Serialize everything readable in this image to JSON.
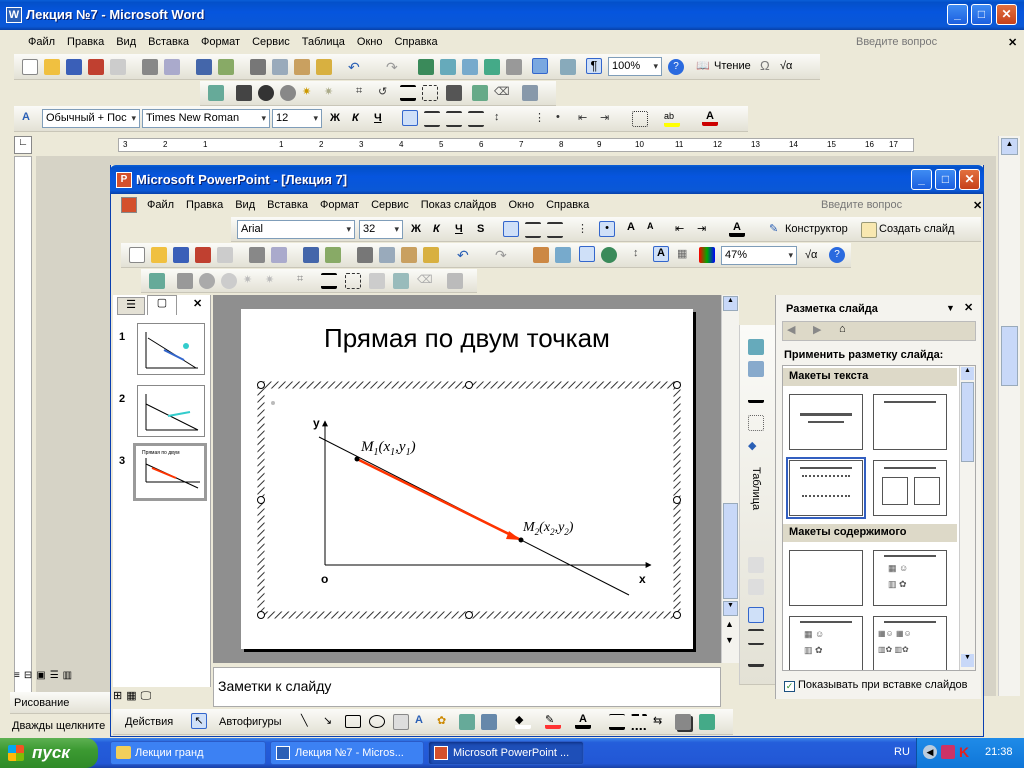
{
  "word": {
    "title": "Лекция №7 - Microsoft Word",
    "menu": [
      "Файл",
      "Правка",
      "Вид",
      "Вставка",
      "Формат",
      "Сервис",
      "Таблица",
      "Окно",
      "Справка"
    ],
    "help_placeholder": "Введите вопрос",
    "zoom": "100%",
    "reading": "Чтение",
    "style": "Обычный + Пос",
    "font": "Times New Roman",
    "size": "12",
    "bold": "Ж",
    "italic": "К",
    "underline": "Ч",
    "ruler_ticks": [
      "3",
      "2",
      "1",
      "1",
      "2",
      "3",
      "4",
      "5",
      "6",
      "7",
      "8",
      "9",
      "10",
      "11",
      "12",
      "13",
      "14",
      "15",
      "16",
      "17"
    ],
    "draw_label": "Рисование",
    "status_text": "Дважды щелкните"
  },
  "ppt": {
    "title": "Microsoft PowerPoint - [Лекция 7]",
    "menu": [
      "Файл",
      "Правка",
      "Вид",
      "Вставка",
      "Формат",
      "Сервис",
      "Показ слайдов",
      "Окно",
      "Справка"
    ],
    "help_placeholder": "Введите вопрос",
    "font": "Arial",
    "size": "32",
    "bold": "Ж",
    "italic": "К",
    "underline": "Ч",
    "shadow": "S",
    "designer": "Конструктор",
    "new_slide": "Создать слайд",
    "zoom": "47%",
    "slide_numbers": [
      "1",
      "2",
      "3"
    ],
    "slide": {
      "title": "Прямая по двум точкам",
      "axis_y": "y",
      "axis_x": "x",
      "origin": "o",
      "m1": {
        "M": "M",
        "sub": "1",
        "open": "(x",
        "s1": "1",
        ",": ",",
        "y": "y",
        "s2": "1",
        "close": ")"
      },
      "m2": {
        "M": "M",
        "sub": "2",
        "open": "(x",
        "s1": "2",
        ",": ",",
        "y": "y",
        "s2": "2",
        "close": ")"
      }
    },
    "side_tab_label": "Таблица",
    "notes": "Заметки к слайду",
    "actions": "Действия",
    "autoshapes": "Автофигуры",
    "taskpane": {
      "title": "Разметка слайда",
      "apply": "Применить разметку слайда:",
      "text_layouts": "Макеты текста",
      "content_layouts": "Макеты содержимого",
      "show_on_insert": "Показывать при вставке слайдов"
    }
  },
  "taskbar": {
    "start": "пуск",
    "items": [
      "Лекции гранд",
      "Лекция №7 - Micros...",
      "Microsoft PowerPoint ..."
    ],
    "lang": "RU",
    "clock": "21:38"
  },
  "colors": {
    "accent": "#ff3300",
    "xp_blue": "#0a58d6",
    "start_green": "#3c9a32"
  }
}
